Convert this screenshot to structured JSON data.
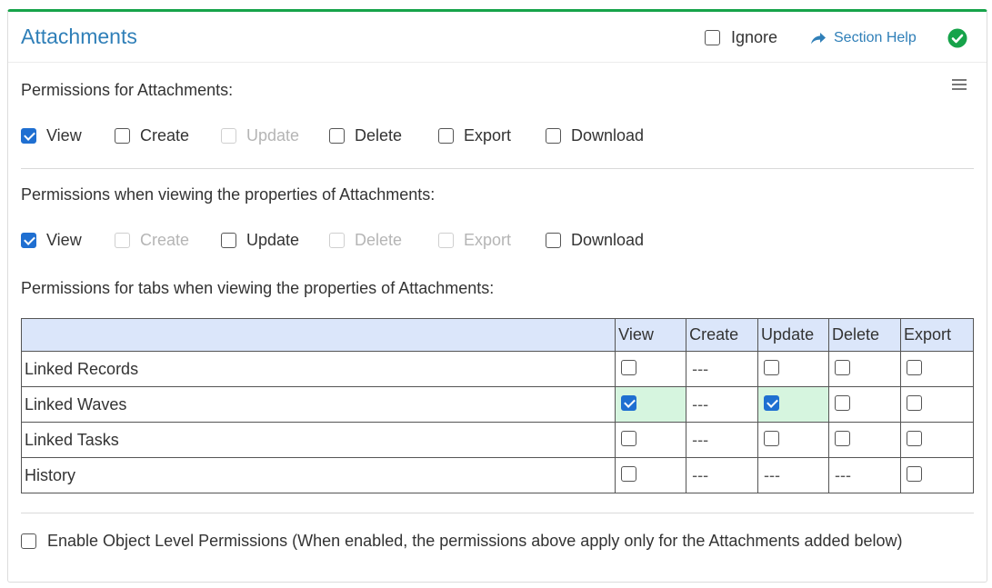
{
  "header": {
    "title": "Attachments",
    "ignore_label": "Ignore",
    "ignore_checked": false,
    "help_label": "Section Help",
    "status_color": "#16a34a"
  },
  "sections": {
    "attachments_label": "Permissions for Attachments:",
    "properties_label": "Permissions when viewing the properties of Attachments:",
    "tabs_label": "Permissions for tabs when viewing the properties of Attachments:"
  },
  "perm_attachments": [
    {
      "label": "View",
      "checked": true,
      "disabled": false
    },
    {
      "label": "Create",
      "checked": false,
      "disabled": false
    },
    {
      "label": "Update",
      "checked": false,
      "disabled": true
    },
    {
      "label": "Delete",
      "checked": false,
      "disabled": false
    },
    {
      "label": "Export",
      "checked": false,
      "disabled": false
    },
    {
      "label": "Download",
      "checked": false,
      "disabled": false
    }
  ],
  "perm_properties": [
    {
      "label": "View",
      "checked": true,
      "disabled": false
    },
    {
      "label": "Create",
      "checked": false,
      "disabled": true
    },
    {
      "label": "Update",
      "checked": false,
      "disabled": false
    },
    {
      "label": "Delete",
      "checked": false,
      "disabled": true
    },
    {
      "label": "Export",
      "checked": false,
      "disabled": true
    },
    {
      "label": "Download",
      "checked": false,
      "disabled": false
    }
  ],
  "tabs_table": {
    "columns": [
      "",
      "View",
      "Create",
      "Update",
      "Delete",
      "Export"
    ],
    "rows": [
      {
        "name": "Linked Records",
        "view": "unchecked",
        "create": "---",
        "update": "unchecked",
        "delete": "unchecked",
        "export": "unchecked"
      },
      {
        "name": "Linked Waves",
        "view": "checked",
        "create": "---",
        "update": "checked",
        "delete": "unchecked",
        "export": "unchecked"
      },
      {
        "name": "Linked Tasks",
        "view": "unchecked",
        "create": "---",
        "update": "unchecked",
        "delete": "unchecked",
        "export": "unchecked"
      },
      {
        "name": "History",
        "view": "unchecked",
        "create": "---",
        "update": "---",
        "delete": "---",
        "export": "unchecked"
      }
    ]
  },
  "object_level": {
    "label": "Enable Object Level Permissions (When enabled, the permissions above apply only for the Attachments added below)",
    "checked": false
  },
  "colors": {
    "accent": "#2f7fb8",
    "checkbox_checked": "#1f6fd1",
    "table_header_bg": "#dbe6fa",
    "checked_cell_bg": "#d6f5df"
  }
}
